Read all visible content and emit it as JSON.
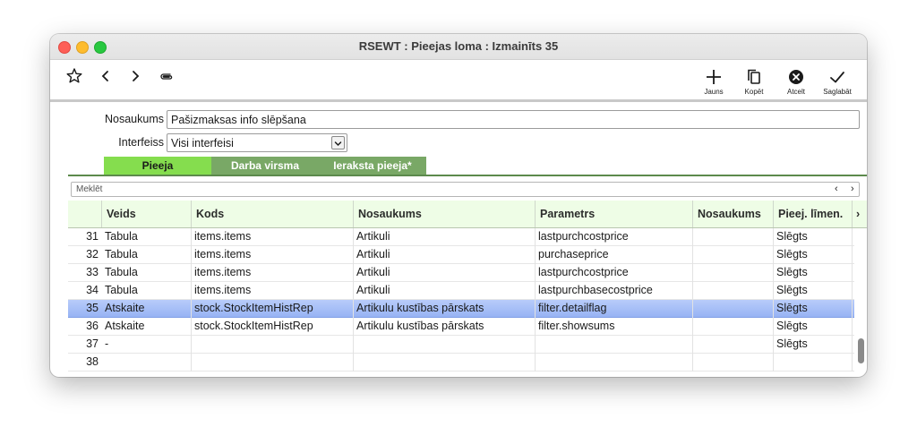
{
  "window": {
    "title": "RSEWT : Pieejas loma : Izmainīts 35"
  },
  "toolbar": {
    "new_label": "Jauns",
    "copy_label": "Kopēt",
    "cancel_label": "Atcelt",
    "save_label": "Saglabāt"
  },
  "form": {
    "name_label": "Nosaukums",
    "name_value": "Pašizmaksas info slēpšana",
    "interface_label": "Interfeiss",
    "interface_value": "Visi interfeisi"
  },
  "tabs": [
    {
      "label": "Pieeja"
    },
    {
      "label": "Darba virsma"
    },
    {
      "label": "Ieraksta pieeja*"
    }
  ],
  "search": {
    "placeholder": "Meklēt",
    "prev": "‹",
    "next": "›"
  },
  "table": {
    "headers": [
      "Veids",
      "Kods",
      "Nosaukums",
      "Parametrs",
      "Nosaukums",
      "Pieej. līmen.",
      "›"
    ],
    "rows": [
      {
        "n": "31",
        "veids": "Tabula",
        "kods": "items.items",
        "nos": "Artikuli",
        "param": "lastpurchcostprice",
        "nos2": "",
        "lim": "Slēgts"
      },
      {
        "n": "32",
        "veids": "Tabula",
        "kods": "items.items",
        "nos": "Artikuli",
        "param": "purchaseprice",
        "nos2": "",
        "lim": "Slēgts"
      },
      {
        "n": "33",
        "veids": "Tabula",
        "kods": "items.items",
        "nos": "Artikuli",
        "param": "lastpurchcostprice",
        "nos2": "",
        "lim": "Slēgts"
      },
      {
        "n": "34",
        "veids": "Tabula",
        "kods": "items.items",
        "nos": "Artikuli",
        "param": "lastpurchbasecostprice",
        "nos2": "",
        "lim": "Slēgts"
      },
      {
        "n": "35",
        "veids": "Atskaite",
        "kods": "stock.StockItemHistRep",
        "nos": "Artikulu kustības pārskats",
        "param": "filter.detailflag",
        "nos2": "",
        "lim": "Slēgts"
      },
      {
        "n": "36",
        "veids": "Atskaite",
        "kods": "stock.StockItemHistRep",
        "nos": "Artikulu kustības pārskats",
        "param": "filter.showsums",
        "nos2": "",
        "lim": "Slēgts"
      },
      {
        "n": "37",
        "veids": "-",
        "kods": "",
        "nos": "",
        "param": "",
        "nos2": "",
        "lim": "Slēgts"
      },
      {
        "n": "38",
        "veids": "",
        "kods": "",
        "nos": "",
        "param": "",
        "nos2": "",
        "lim": ""
      }
    ]
  },
  "selected_row": "35"
}
